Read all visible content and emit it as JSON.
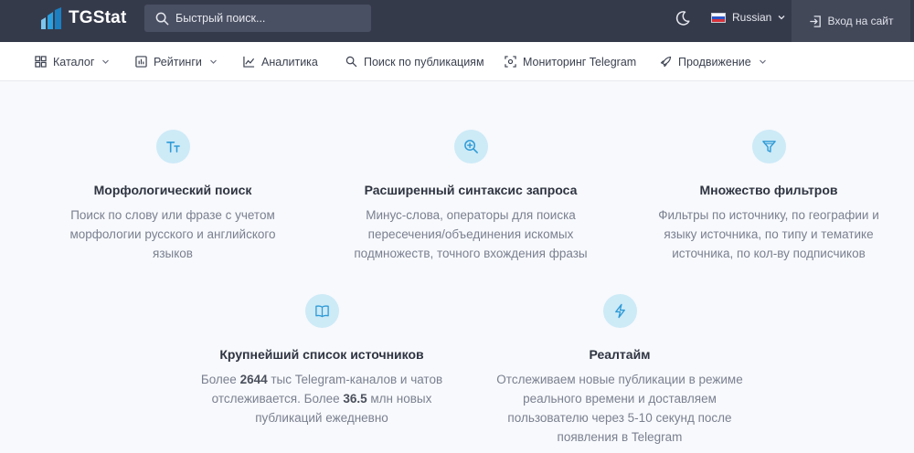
{
  "header": {
    "brand": "TGStat",
    "search_placeholder": "Быстрый поиск...",
    "language": "Russian",
    "login_label": "Вход на сайт"
  },
  "nav": {
    "items": [
      {
        "label": "Каталог",
        "icon": "grid-icon",
        "dropdown": true
      },
      {
        "label": "Рейтинги",
        "icon": "ranking-icon",
        "dropdown": true
      },
      {
        "label": "Аналитика",
        "icon": "chart-line-icon",
        "dropdown": false
      },
      {
        "label": "Поиск по публикациям",
        "icon": "search-icon",
        "dropdown": false
      },
      {
        "label": "Мониторинг Telegram",
        "icon": "scan-icon",
        "dropdown": false
      },
      {
        "label": "Продвижение",
        "icon": "rocket-icon",
        "dropdown": true
      }
    ]
  },
  "features": [
    {
      "icon": "text-type-icon",
      "title": "Морфологический поиск",
      "desc": "Поиск по слову или фразе с учетом морфологии русского и английского языков"
    },
    {
      "icon": "zoom-in-icon",
      "title": "Расширенный синтаксис запроса",
      "desc": "Минус-слова, операторы для поиска пересечения/объединения искомых подмножеств, точного вхождения фразы"
    },
    {
      "icon": "filter-icon",
      "title": "Множество фильтров",
      "desc": "Фильтры по источнику, по географии и языку источника, по типу и тематике источника, по кол-ву подписчиков"
    },
    {
      "icon": "book-icon",
      "title": "Крупнейший список источников",
      "desc_before": "Более ",
      "desc_num1": "2644",
      "desc_mid": " тыс Telegram-каналов и чатов отслеживается. Более ",
      "desc_num2": "36.5",
      "desc_after": " млн новых публикаций ежедневно"
    },
    {
      "icon": "lightning-icon",
      "title": "Реалтайм",
      "desc": "Отслеживаем новые публикации в режиме реального времени и доставляем пользователю через 5-10 секунд после появления в Telegram"
    }
  ],
  "colors": {
    "topbar": "#353a4b",
    "accent_circle": "#cdeaf7",
    "accent_icon": "#2f9bd6",
    "logo_blue": "#2aa0e0"
  }
}
